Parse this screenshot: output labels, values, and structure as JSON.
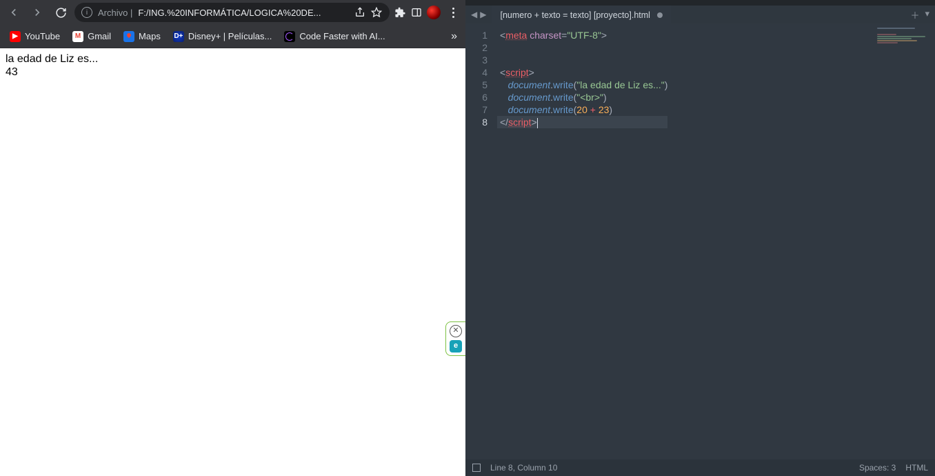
{
  "chrome": {
    "address_scheme": "Archivo |",
    "address_url": "F:/ING.%20INFORMÁTICA/LOGICA%20DE...",
    "bookmarks": [
      {
        "label": "YouTube",
        "fav": "fav-yt",
        "glyph": "▶"
      },
      {
        "label": "Gmail",
        "fav": "fav-gm",
        "glyph": "M"
      },
      {
        "label": "Maps",
        "fav": "fav-maps",
        "glyph": ""
      },
      {
        "label": "Disney+ | Películas...",
        "fav": "fav-dis",
        "glyph": "D+"
      },
      {
        "label": "Code Faster with AI...",
        "fav": "fav-cf",
        "glyph": ""
      }
    ],
    "page_line1": "la edad de Liz es...",
    "page_line2": "43"
  },
  "editor": {
    "tab_title": "[numero + texto = texto] [proyecto].html",
    "lines": [
      "1",
      "2",
      "3",
      "4",
      "5",
      "6",
      "7",
      "8"
    ],
    "highlight_line_index": 7,
    "code": {
      "meta_tag": "meta",
      "meta_attr": "charset",
      "meta_val": "\"UTF-8\"",
      "script_open": "script",
      "doc": "document",
      "write": "write",
      "s1": "\"la edad de Liz es...\"",
      "s2": "\"<br>\"",
      "n1": "20",
      "n2": "23",
      "script_close": "script"
    },
    "status": {
      "pos": "Line 8, Column 10",
      "spaces": "Spaces: 3",
      "lang": "HTML"
    }
  }
}
